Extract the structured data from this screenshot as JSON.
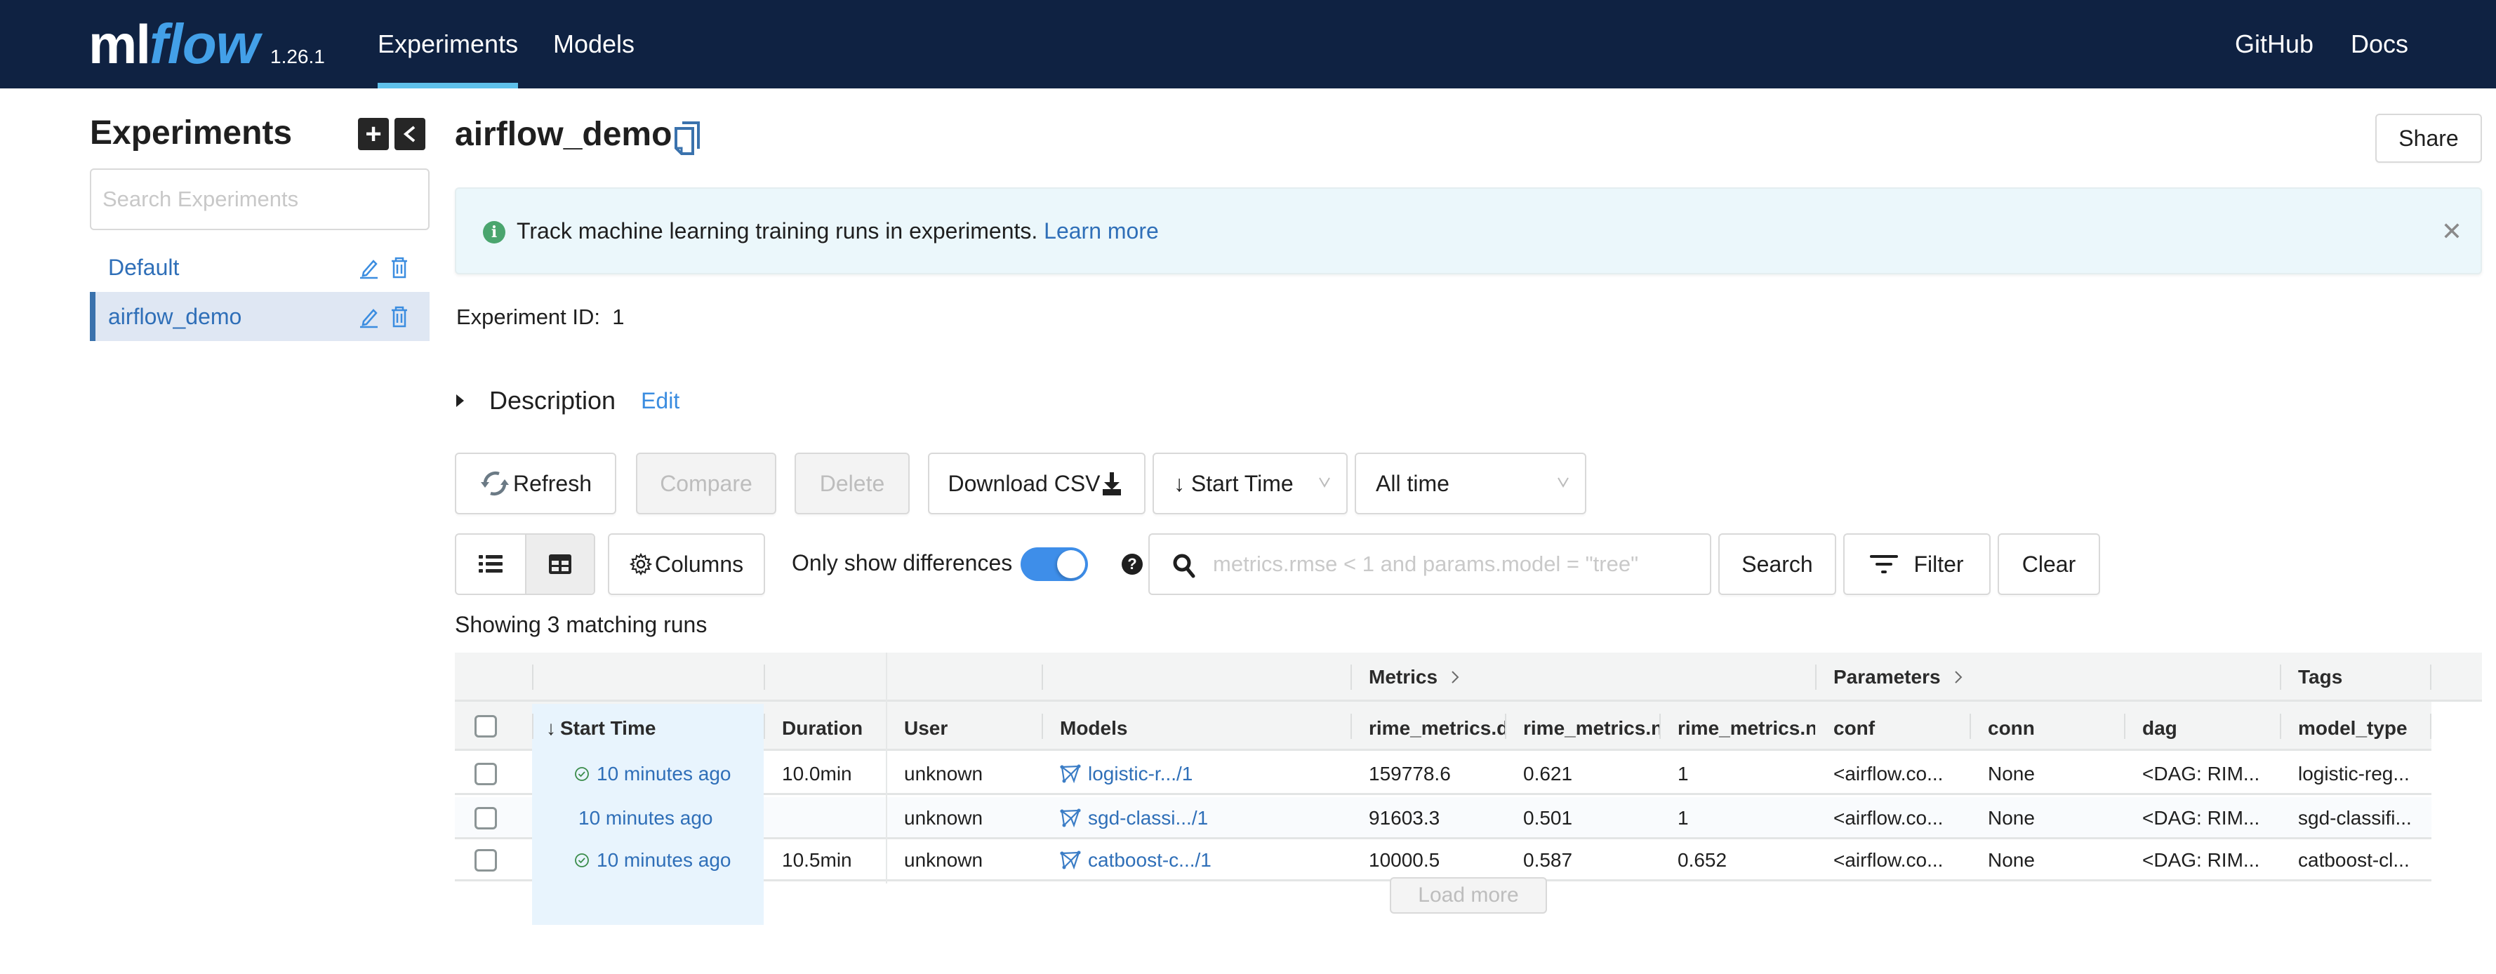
{
  "nav": {
    "logo_ml": "ml",
    "logo_flow": "flow",
    "version": "1.26.1",
    "links": [
      {
        "label": "Experiments",
        "active": true
      },
      {
        "label": "Models",
        "active": false
      }
    ],
    "right_links": [
      "GitHub",
      "Docs"
    ],
    "accent_color": "#5ec0ea",
    "background_color": "#0f2242"
  },
  "sidebar": {
    "title": "Experiments",
    "add_icon": "plus-icon",
    "collapse_icon": "chevron-left-icon",
    "search_placeholder": "Search Experiments",
    "items": [
      {
        "label": "Default",
        "active": false
      },
      {
        "label": "airflow_demo",
        "active": true
      }
    ]
  },
  "header": {
    "title": "airflow_demo",
    "copy_icon": "copy-icon",
    "share_label": "Share"
  },
  "alert": {
    "message": "Track machine learning training runs in experiments.",
    "link_label": "Learn more",
    "close_icon": "close-icon"
  },
  "experiment": {
    "id_label": "Experiment ID",
    "id_value": "1"
  },
  "description": {
    "label": "Description",
    "edit_label": "Edit"
  },
  "toolbar": {
    "refresh_label": "Refresh",
    "compare_label": "Compare",
    "delete_label": "Delete",
    "download_label": "Download CSV",
    "sort_label": "↓ Start Time",
    "time_filter_label": "All time",
    "columns_label": "Columns",
    "diff_label": "Only show differences",
    "diff_enabled": true,
    "search_placeholder": "metrics.rmse < 1 and params.model = \"tree\"",
    "search_value": "",
    "search_label": "Search",
    "filter_label": "Filter",
    "clear_label": "Clear"
  },
  "runs": {
    "count_label": "Showing 3 matching runs",
    "groups": {
      "metrics": "Metrics",
      "parameters": "Parameters",
      "tags": "Tags"
    },
    "columns": [
      "Start Time",
      "Duration",
      "User",
      "Models",
      "rime_metrics.d",
      "rime_metrics.n",
      "rime_metrics.n",
      "conf",
      "conn",
      "dag",
      "model_type"
    ],
    "sort_indicator": "↓",
    "rows": [
      {
        "status": "finished",
        "start_time": "10 minutes ago",
        "duration": "10.0min",
        "user": "unknown",
        "model": "logistic-r.../1",
        "m1": "159778.6",
        "m2": "0.621",
        "m3": "1",
        "conf": "<airflow.co...",
        "conn": "None",
        "dag": "<DAG: RIM...",
        "model_type": "logistic-reg..."
      },
      {
        "status": "running",
        "start_time": "10 minutes ago",
        "duration": "",
        "user": "unknown",
        "model": "sgd-classi.../1",
        "m1": "91603.3",
        "m2": "0.501",
        "m3": "1",
        "conf": "<airflow.co...",
        "conn": "None",
        "dag": "<DAG: RIM...",
        "model_type": "sgd-classifi..."
      },
      {
        "status": "finished",
        "start_time": "10 minutes ago",
        "duration": "10.5min",
        "user": "unknown",
        "model": "catboost-c.../1",
        "m1": "10000.5",
        "m2": "0.587",
        "m3": "0.652",
        "conf": "<airflow.co...",
        "conn": "None",
        "dag": "<DAG: RIM...",
        "model_type": "catboost-cl..."
      }
    ],
    "load_more_label": "Load more"
  }
}
